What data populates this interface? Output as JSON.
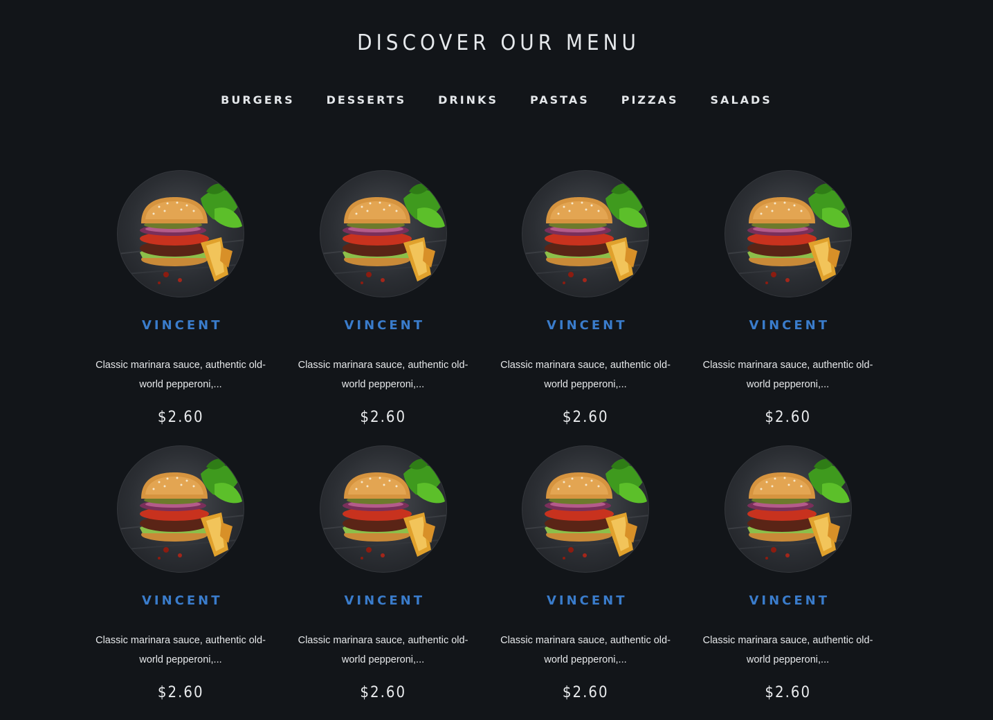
{
  "page": {
    "title": "DISCOVER OUR MENU"
  },
  "tabs": [
    {
      "label": "BURGERS"
    },
    {
      "label": "DESSERTS"
    },
    {
      "label": "DRINKS"
    },
    {
      "label": "PASTAS"
    },
    {
      "label": "PIZZAS"
    },
    {
      "label": "SALADS"
    }
  ],
  "colors": {
    "background": "#121519",
    "accent": "#3a7ccb",
    "text": "#e6e9ec"
  },
  "items": [
    {
      "image_icon": "burger-image",
      "name": "VINCENT",
      "description": "Classic marinara sauce, authentic old-world pepperoni,...",
      "price": "$2.60"
    },
    {
      "image_icon": "burger-image",
      "name": "VINCENT",
      "description": "Classic marinara sauce, authentic old-world pepperoni,...",
      "price": "$2.60"
    },
    {
      "image_icon": "burger-image",
      "name": "VINCENT",
      "description": "Classic marinara sauce, authentic old-world pepperoni,...",
      "price": "$2.60"
    },
    {
      "image_icon": "burger-image",
      "name": "VINCENT",
      "description": "Classic marinara sauce, authentic old-world pepperoni,...",
      "price": "$2.60"
    },
    {
      "image_icon": "burger-image",
      "name": "VINCENT",
      "description": "Classic marinara sauce, authentic old-world pepperoni,...",
      "price": "$2.60"
    },
    {
      "image_icon": "burger-image",
      "name": "VINCENT",
      "description": "Classic marinara sauce, authentic old-world pepperoni,...",
      "price": "$2.60"
    },
    {
      "image_icon": "burger-image",
      "name": "VINCENT",
      "description": "Classic marinara sauce, authentic old-world pepperoni,...",
      "price": "$2.60"
    },
    {
      "image_icon": "burger-image",
      "name": "VINCENT",
      "description": "Classic marinara sauce, authentic old-world pepperoni,...",
      "price": "$2.60"
    }
  ]
}
